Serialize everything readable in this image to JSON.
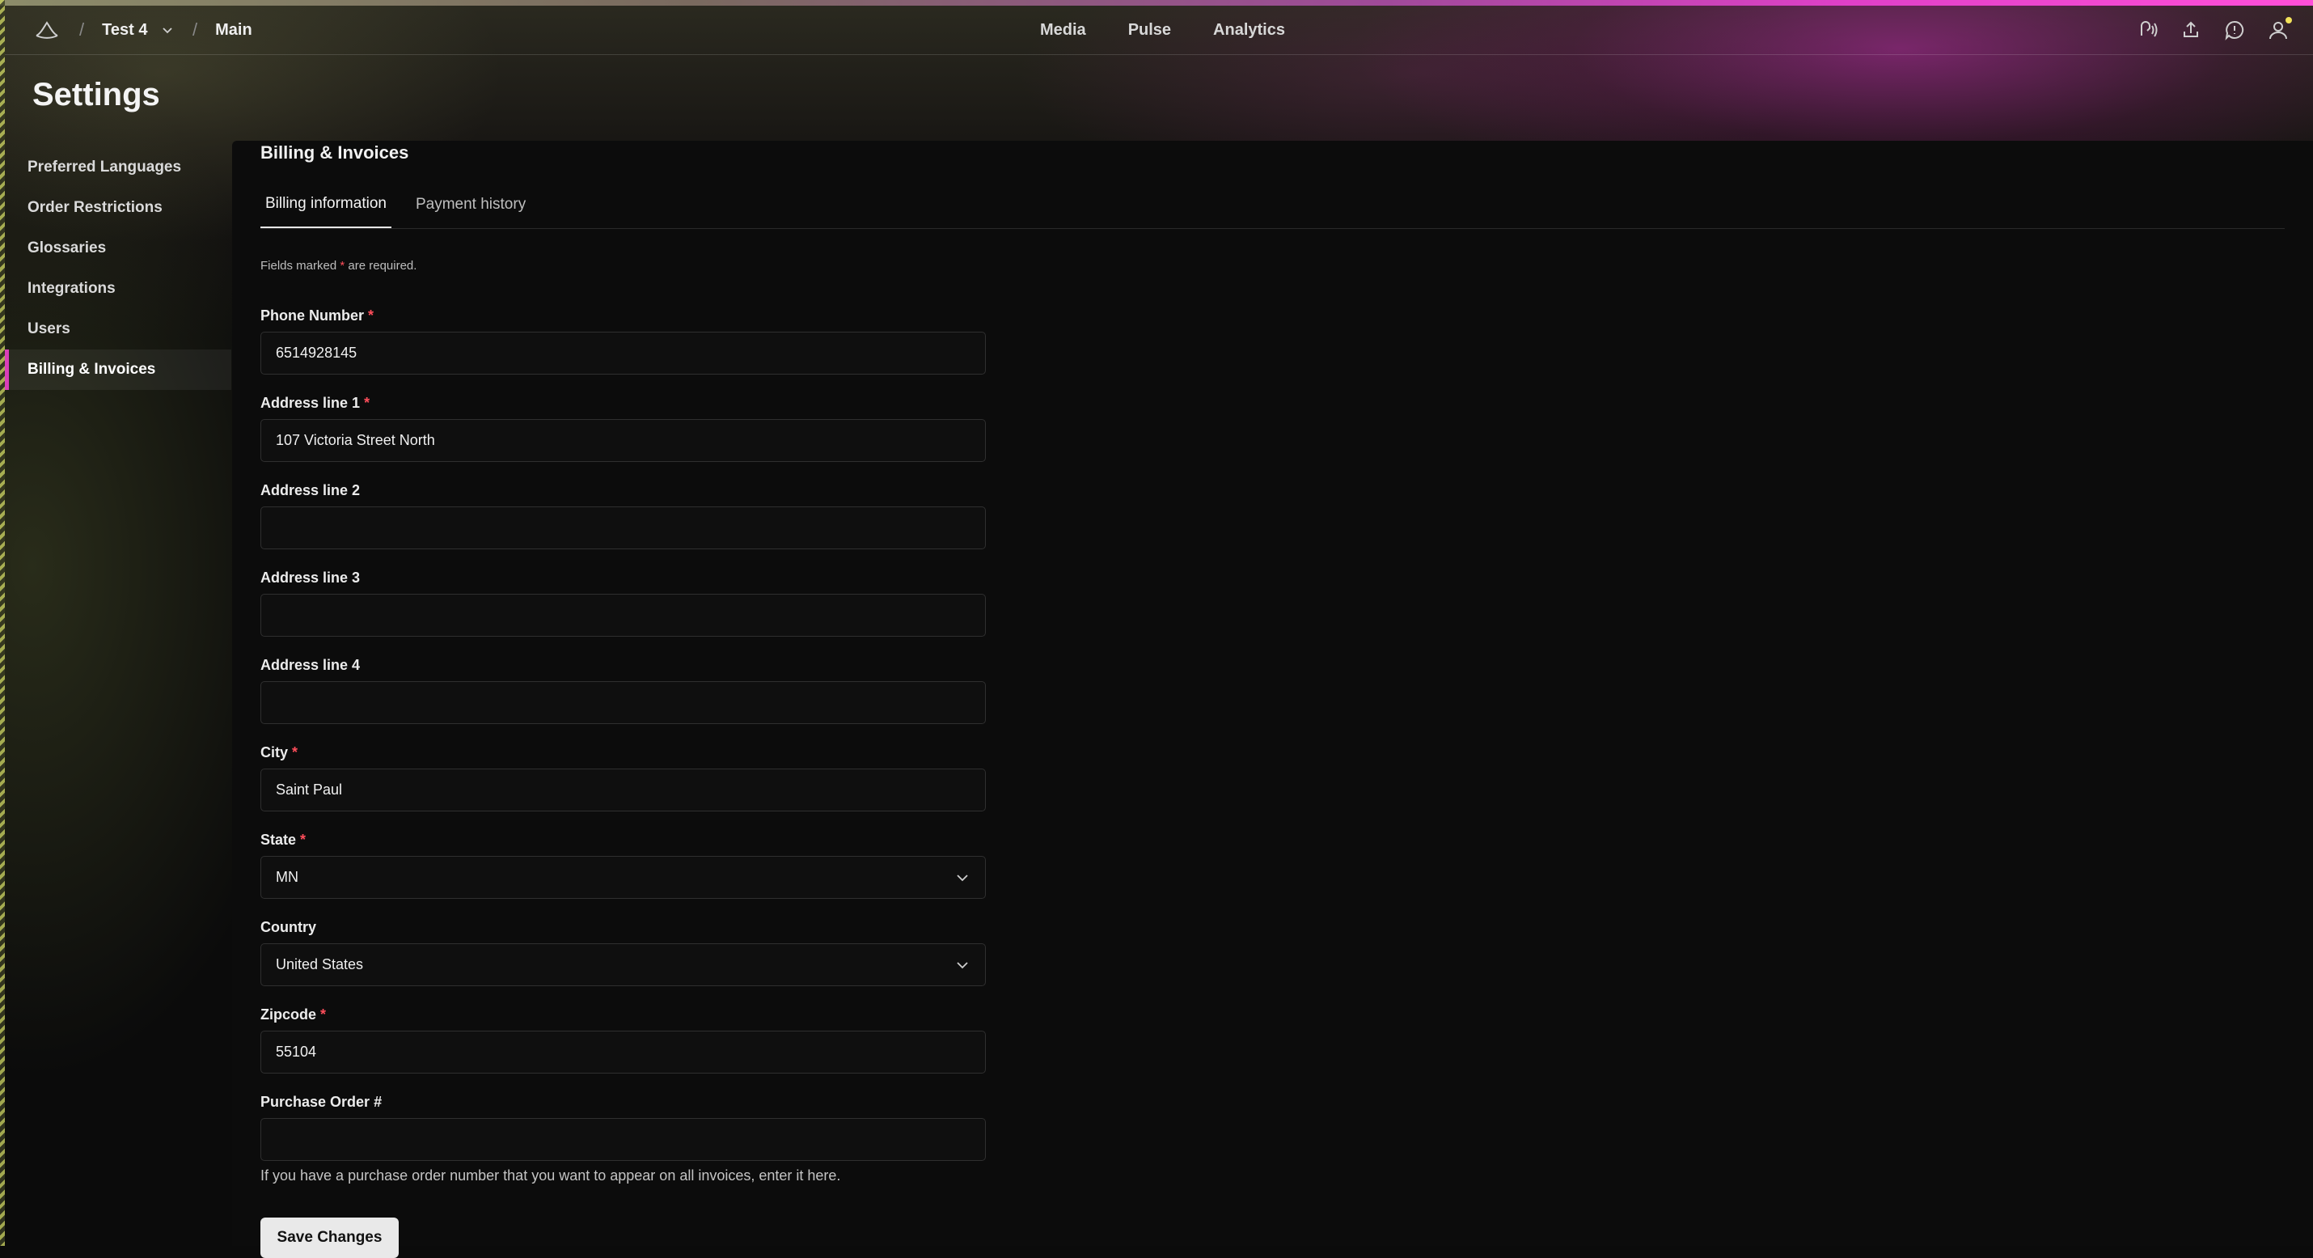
{
  "header": {
    "project": "Test 4",
    "branch": "Main",
    "nav": [
      "Media",
      "Pulse",
      "Analytics"
    ],
    "icons": [
      "voice-icon",
      "upload-icon",
      "feedback-icon",
      "account-icon"
    ]
  },
  "page": {
    "title": "Settings"
  },
  "sidebar": {
    "items": [
      {
        "label": "Preferred Languages"
      },
      {
        "label": "Order Restrictions"
      },
      {
        "label": "Glossaries"
      },
      {
        "label": "Integrations"
      },
      {
        "label": "Users"
      },
      {
        "label": "Billing & Invoices"
      }
    ],
    "active": "Billing & Invoices"
  },
  "main": {
    "section_title": "Billing & Invoices",
    "tabs": [
      {
        "label": "Billing information"
      },
      {
        "label": "Payment history"
      }
    ],
    "note_prefix": "Fields marked",
    "note_star": "*",
    "note_suffix": "are required.",
    "fields": {
      "phone": {
        "label": "Phone Number",
        "value": "6514928145"
      },
      "addr1": {
        "label": "Address line 1",
        "value": "107 Victoria Street North"
      },
      "addr2": {
        "label": "Address line 2",
        "value": ""
      },
      "addr3": {
        "label": "Address line 3",
        "value": ""
      },
      "addr4": {
        "label": "Address line 4",
        "value": ""
      },
      "city": {
        "label": "City",
        "value": "Saint Paul"
      },
      "state": {
        "label": "State",
        "value": "MN"
      },
      "country": {
        "label": "Country",
        "value": "United States"
      },
      "zip": {
        "label": "Zipcode",
        "value": "55104"
      },
      "po": {
        "label": "Purchase Order #",
        "value": "",
        "help": "If you have a purchase order number that you want to appear on all invoices, enter it here."
      }
    },
    "save_label": "Save Changes"
  },
  "colors": {
    "accent": "#d93fb8",
    "required": "#ff4e5b"
  }
}
